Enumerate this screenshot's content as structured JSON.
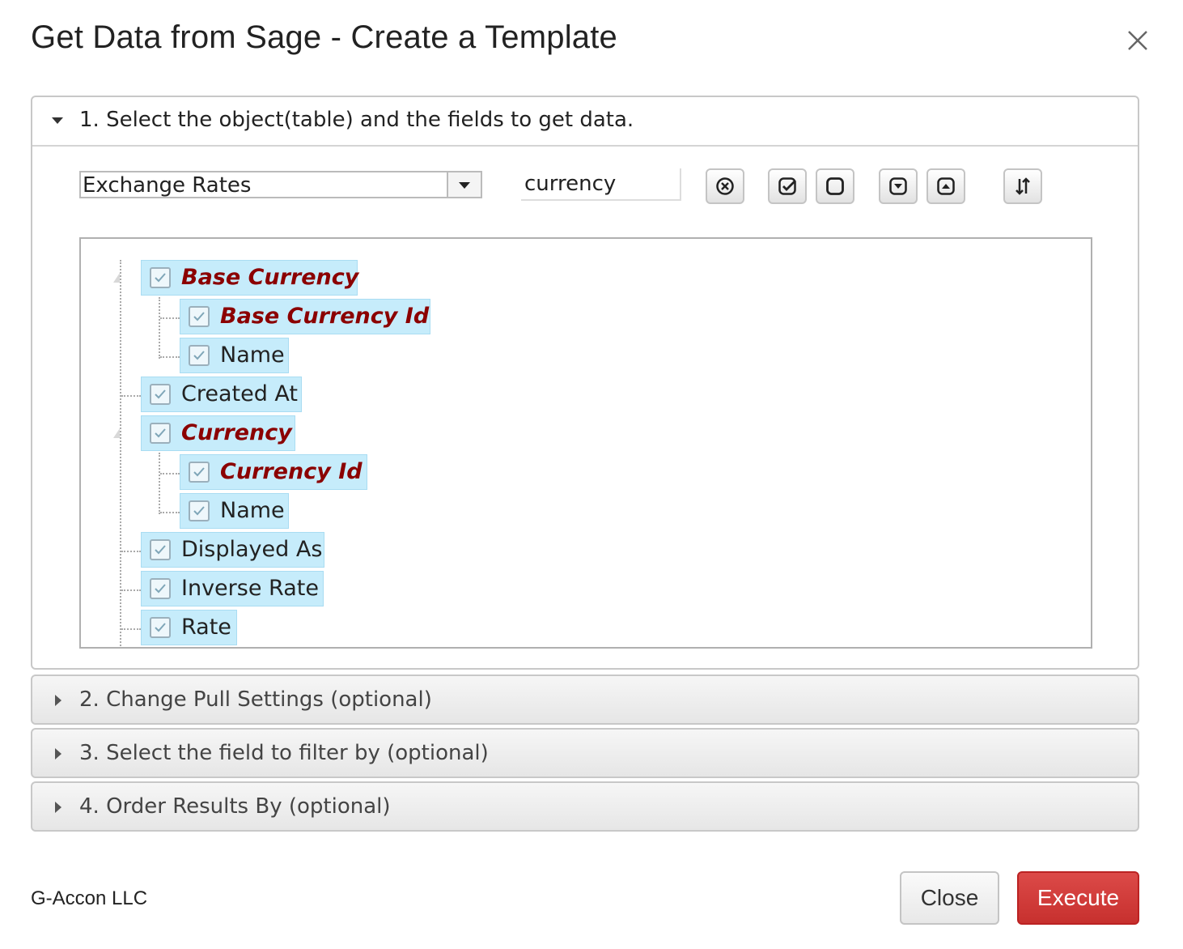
{
  "dialog": {
    "title": "Get Data from Sage - Create a Template",
    "close_glyph": "×"
  },
  "section1": {
    "header": "1. Select the object(table) and the fields to get data.",
    "object_select": {
      "value": "Exchange Rates"
    },
    "search": {
      "value": "currency",
      "placeholder": ""
    },
    "toolbar_icons": [
      "clear-search-icon",
      "check-all-icon",
      "uncheck-all-icon",
      "expand-all-icon",
      "collapse-all-icon",
      "sort-icon"
    ],
    "tree": [
      {
        "label": "Base Currency",
        "key": true,
        "checked": true,
        "level": 0,
        "expandable": true
      },
      {
        "label": "Base Currency Id",
        "key": true,
        "checked": true,
        "level": 1
      },
      {
        "label": "Name",
        "key": false,
        "checked": true,
        "level": 1
      },
      {
        "label": "Created At",
        "key": false,
        "checked": true,
        "level": 0
      },
      {
        "label": "Currency",
        "key": true,
        "checked": true,
        "level": 0,
        "expandable": true
      },
      {
        "label": "Currency Id",
        "key": true,
        "checked": true,
        "level": 1
      },
      {
        "label": "Name",
        "key": false,
        "checked": true,
        "level": 1
      },
      {
        "label": "Displayed As",
        "key": false,
        "checked": true,
        "level": 0
      },
      {
        "label": "Inverse Rate",
        "key": false,
        "checked": true,
        "level": 0
      },
      {
        "label": "Rate",
        "key": false,
        "checked": true,
        "level": 0
      }
    ]
  },
  "section2": {
    "header": "2. Change Pull Settings (optional)"
  },
  "section3": {
    "header": "3. Select the field to filter by (optional)"
  },
  "section4": {
    "header": "4. Order Results By (optional)"
  },
  "footer": {
    "company": "G-Accon LLC",
    "close_label": "Close",
    "execute_label": "Execute"
  },
  "colors": {
    "tree_highlight": "#c6ecfb",
    "key_field_text": "#8b0000",
    "execute_button": "#d03a38"
  }
}
